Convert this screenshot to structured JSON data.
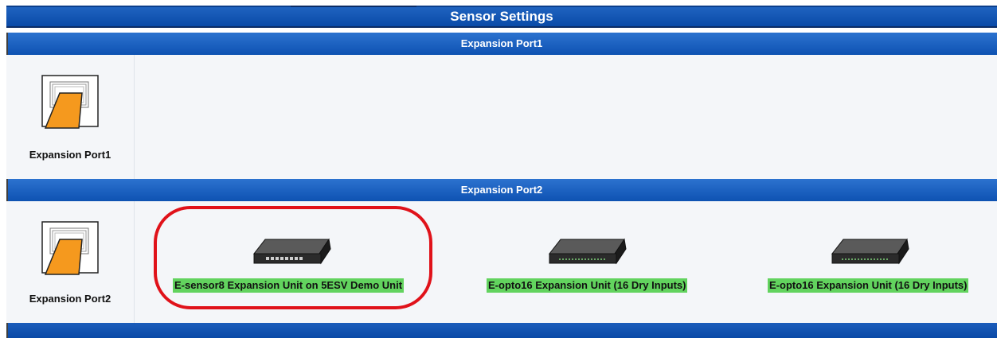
{
  "header": {
    "title": "Sensor Settings"
  },
  "sections": [
    {
      "title": "Expansion Port1",
      "port_label": "Expansion Port1",
      "units": []
    },
    {
      "title": "Expansion Port2",
      "port_label": "Expansion Port2",
      "units": [
        {
          "label": "E-sensor8 Expansion Unit on 5ESV Demo Unit",
          "icon": "expansion-unit-icon",
          "highlighted": true
        },
        {
          "label": "E-opto16 Expansion Unit (16 Dry Inputs)",
          "icon": "expansion-unit-icon",
          "highlighted": false
        },
        {
          "label": "E-opto16 Expansion Unit (16 Dry Inputs)",
          "icon": "expansion-unit-icon",
          "highlighted": false
        }
      ]
    }
  ],
  "colors": {
    "header_blue": "#1f63bf",
    "unit_label_green": "#62d35e",
    "highlight_red": "#e0121a",
    "cable_orange": "#f5991e"
  }
}
